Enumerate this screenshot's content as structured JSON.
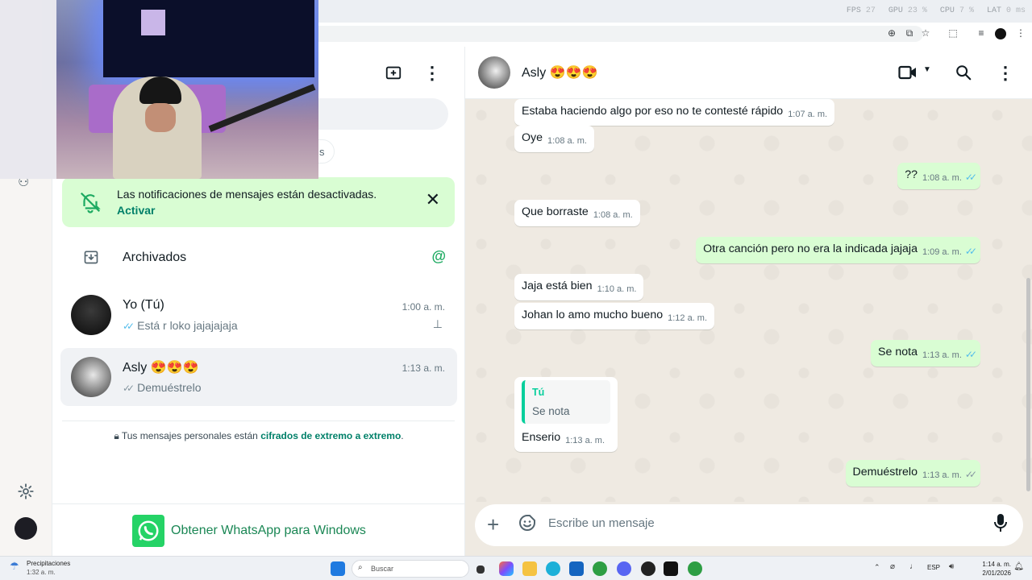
{
  "perf": {
    "fps_label": "FPS",
    "fps": "27",
    "gpu_label": "GPU",
    "gpu": "23 %",
    "cpu_label": "CPU",
    "cpu": "7 %",
    "lat_label": "LAT",
    "lat": "0 ms"
  },
  "notification": {
    "text": "Las notificaciones de mensajes están desactivadas.",
    "action": "Activar"
  },
  "archived_label": "Archivados",
  "chats": [
    {
      "name": "Yo (Tú)",
      "time": "1:00 a. m.",
      "preview": "Está r loko jajajajaja",
      "pinned": true
    },
    {
      "name": "Asly 😍😍😍",
      "time": "1:13 a. m.",
      "preview": "Demuéstrelo",
      "pinned": false
    }
  ],
  "encryption": {
    "prefix": "Tus mensajes personales están",
    "link": "cifrados de extremo a extremo",
    "suffix": "."
  },
  "get_app": "Obtener WhatsApp para Windows",
  "filter_partial": "s",
  "header": {
    "contact": "Asly 😍😍😍"
  },
  "messages": [
    {
      "dir": "in",
      "text": "Estaba haciendo algo por eso no te contesté rápido",
      "time": "1:07 a. m."
    },
    {
      "dir": "in",
      "text": "Oye",
      "time": "1:08 a. m."
    },
    {
      "dir": "out",
      "text": "??",
      "time": "1:08 a. m.",
      "read": true
    },
    {
      "dir": "in",
      "text": "Que borraste",
      "time": "1:08 a. m."
    },
    {
      "dir": "out",
      "text": "Otra canción pero no era la indicada jajaja",
      "time": "1:09 a. m.",
      "read": true
    },
    {
      "dir": "in",
      "text": "Jaja está bien",
      "time": "1:10 a. m."
    },
    {
      "dir": "in",
      "text": "Johan lo amo mucho bueno",
      "time": "1:12 a. m."
    },
    {
      "dir": "out",
      "text": "Se nota",
      "time": "1:13 a. m.",
      "read": true
    },
    {
      "dir": "in",
      "text": "Enserio",
      "time": "1:13 a. m.",
      "quote_author": "Tú",
      "quote_text": "Se nota"
    },
    {
      "dir": "out",
      "text": "Demuéstrelo",
      "time": "1:13 a. m.",
      "read": false
    }
  ],
  "compose": {
    "placeholder": "Escribe un mensaje"
  },
  "taskbar": {
    "weather_title": "Precipitaciones",
    "weather_time": "1:32 a. m.",
    "search": "Buscar",
    "lang": "ESP",
    "time": "1:14 a. m.",
    "date": "2/01/2026"
  },
  "icons": {
    "new_chat": "new-chat-icon",
    "menu": "menu-icon",
    "video": "video-call-icon",
    "search": "search-icon",
    "settings": "gear-icon",
    "mic": "mic-icon",
    "emoji": "emoji-icon",
    "archive": "archive-icon",
    "pin": "pin-icon",
    "lock": "lock-icon"
  },
  "colors": {
    "accent": "#008069",
    "bubble_out": "#d9fdd3",
    "bg": "#efeae2",
    "read_tick": "#53bdeb"
  }
}
